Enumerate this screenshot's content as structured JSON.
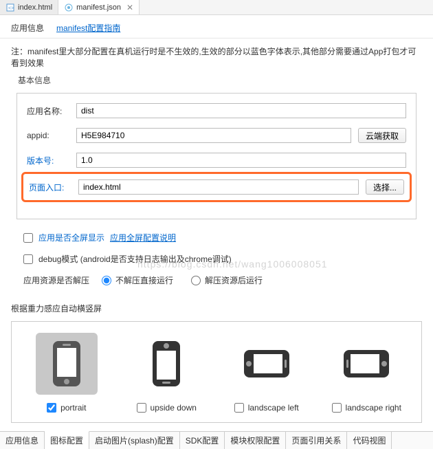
{
  "tabs": {
    "file1": "index.html",
    "file2": "manifest.json"
  },
  "subTabs": {
    "info": "应用信息",
    "guide": "manifest配置指南"
  },
  "note": "注：manifest里大部分配置在真机运行时是不生效的,生效的部分以蓝色字体表示,其他部分需要通过App打包才可看到效果",
  "basic": {
    "title": "基本信息",
    "appNameLabel": "应用名称:",
    "appNameValue": "dist",
    "appidLabel": "appid:",
    "appidValue": "H5E984710",
    "cloudBtn": "云端获取",
    "versionLabel": "版本号:",
    "versionValue": "1.0",
    "entryLabel": "页面入口:",
    "entryValue": "index.html",
    "selectBtn": "选择..."
  },
  "options": {
    "fullscreenLabel": "应用是否全屏显示",
    "fullscreenLink": "应用全屏配置说明",
    "debugLabel": "debug模式 (android是否支持日志输出及chrome调试)",
    "resourceLabel": "应用资源是否解压",
    "radio1": "不解压直接运行",
    "radio2": "解压资源后运行"
  },
  "orientation": {
    "title": "根据重力感应自动横竖屏",
    "portrait": "portrait",
    "upsideDown": "upside down",
    "landscapeLeft": "landscape left",
    "landscapeRight": "landscape right"
  },
  "bottomTabs": [
    "应用信息",
    "图标配置",
    "启动图片(splash)配置",
    "SDK配置",
    "模块权限配置",
    "页面引用关系",
    "代码视图"
  ],
  "watermark": "https://blog.csdn.net/wang1006008051"
}
